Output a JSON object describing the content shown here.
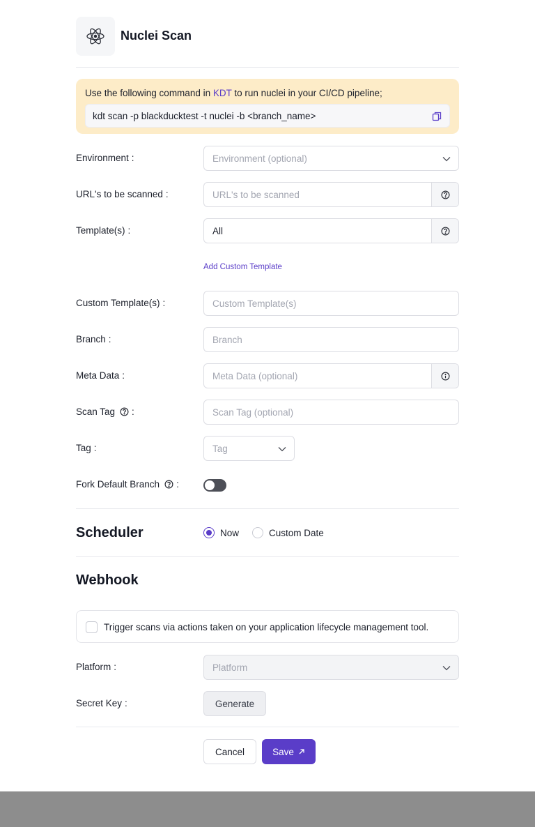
{
  "app": {
    "title": "Nuclei Scan",
    "logo_icon": "atom-icon"
  },
  "command": {
    "intro_before": "Use the following command in ",
    "intro_link": "KDT",
    "intro_after": " to run nuclei in your CI/CD pipeline;",
    "text": "kdt scan -p blackducktest  -t nuclei -b <branch_name>",
    "copy_icon": "copy-icon"
  },
  "form": {
    "environment": {
      "label": "Environment",
      "placeholder": "Environment (optional)"
    },
    "urls": {
      "label": "URL's to be scanned",
      "placeholder": "URL's to be scanned"
    },
    "templates": {
      "label": "Template(s)",
      "value": "All"
    },
    "add_custom_template": "Add Custom Template",
    "custom_templates": {
      "label": "Custom Template(s)",
      "placeholder": "Custom Template(s)"
    },
    "branch": {
      "label": "Branch",
      "placeholder": "Branch"
    },
    "meta_data": {
      "label": "Meta Data",
      "placeholder": "Meta Data (optional)"
    },
    "scan_tag": {
      "label": "Scan Tag",
      "placeholder": "Scan Tag (optional)"
    },
    "tag": {
      "label": "Tag",
      "placeholder": "Tag"
    },
    "fork_default_branch": {
      "label": "Fork Default Branch",
      "enabled": false
    }
  },
  "scheduler": {
    "title": "Scheduler",
    "options": [
      "Now",
      "Custom Date"
    ],
    "selected": "Now"
  },
  "webhook": {
    "title": "Webhook",
    "trigger_text": "Trigger scans via actions taken on your application lifecycle management tool.",
    "trigger_checked": false,
    "platform": {
      "label": "Platform",
      "placeholder": "Platform"
    },
    "secret_key": {
      "label": "Secret Key",
      "button": "Generate"
    }
  },
  "actions": {
    "cancel": "Cancel",
    "save": "Save"
  },
  "colors": {
    "accent": "#5a3dc8",
    "notice_bg": "#fdecc8"
  }
}
